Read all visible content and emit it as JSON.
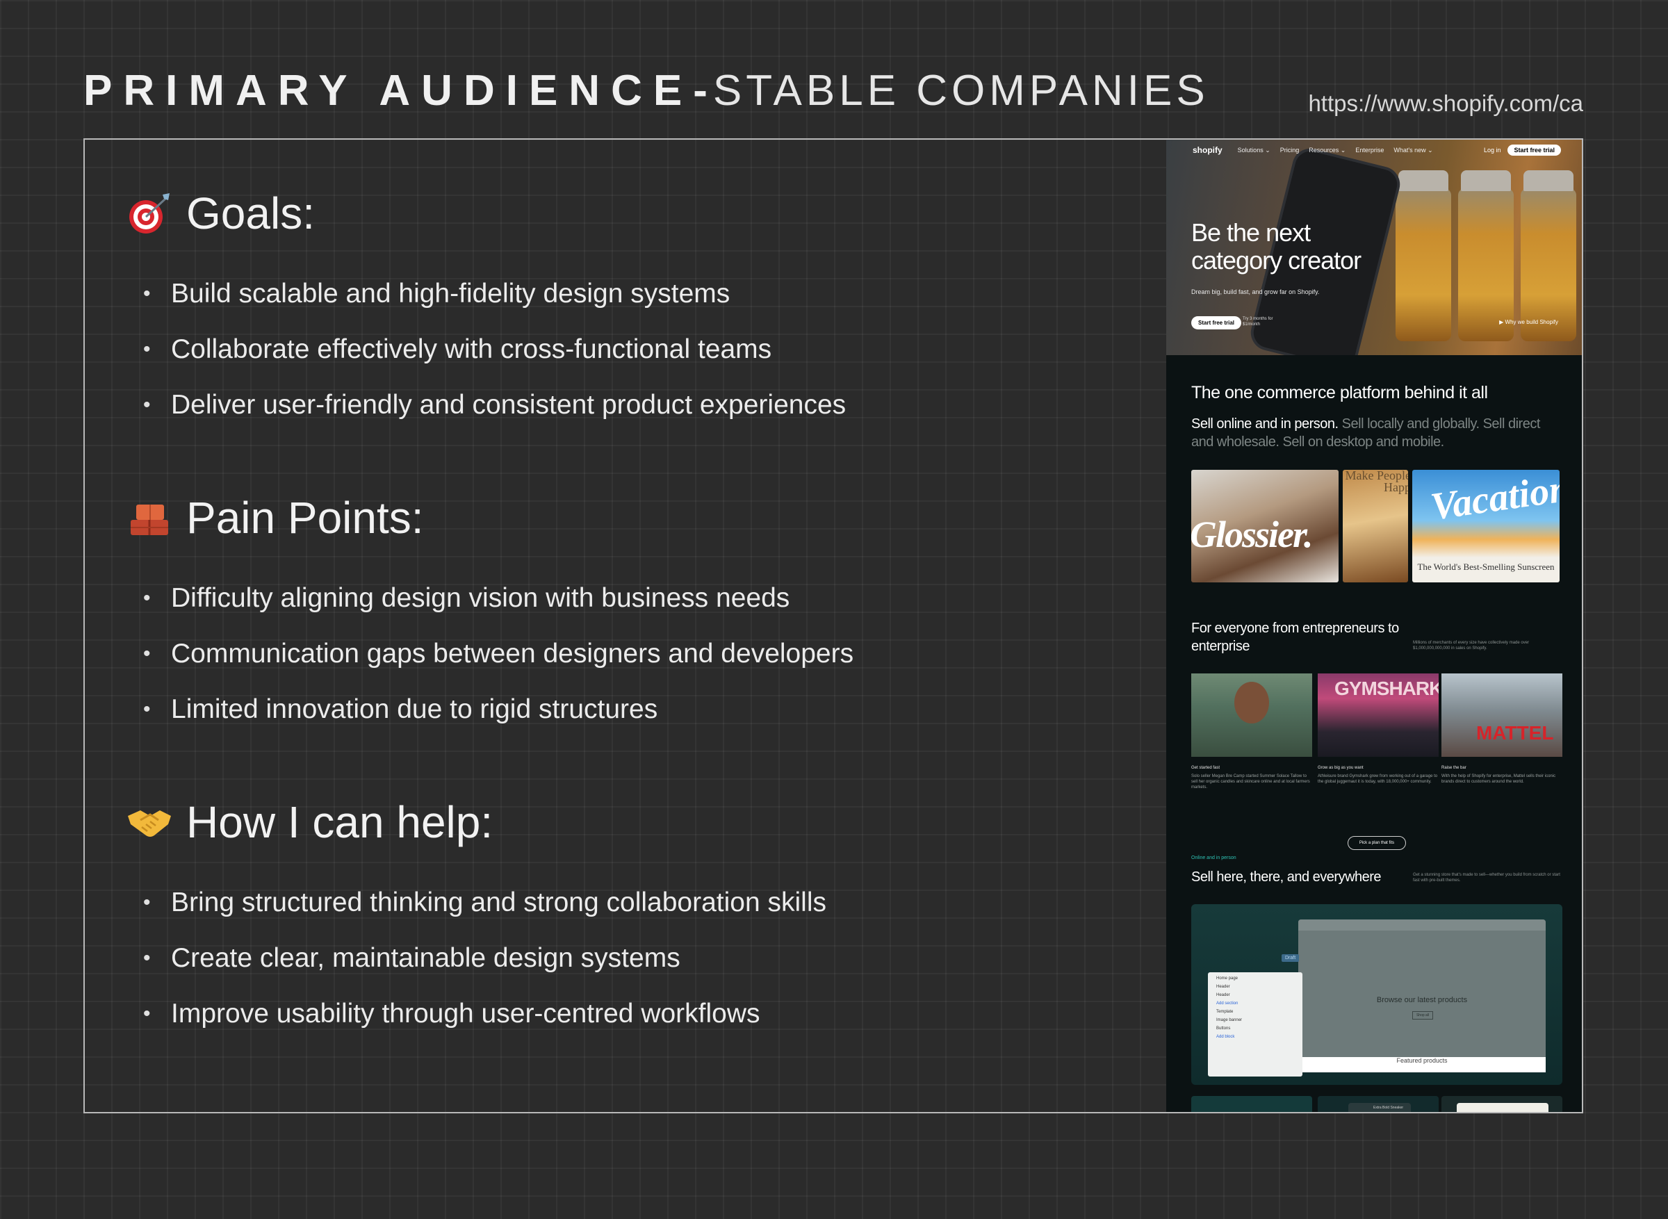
{
  "header": {
    "title_bold": "PRIMARY AUDIENCE",
    "title_sep": "-",
    "title_light": "STABLE COMPANIES",
    "source_url": "https://www.shopify.com/ca"
  },
  "sections": [
    {
      "icon": "dart-target-icon",
      "title": "Goals:",
      "bullets": [
        "Build scalable and high-fidelity design systems",
        "Collaborate effectively with cross-functional teams",
        "Deliver user-friendly and consistent product experiences"
      ]
    },
    {
      "icon": "bricks-icon",
      "title": "Pain Points:",
      "bullets": [
        "Difficulty aligning design vision with business needs",
        "Communication gaps between designers and developers",
        "Limited innovation due to rigid structures"
      ]
    },
    {
      "icon": "handshake-icon",
      "title": "How I can help:",
      "bullets": [
        "Bring structured thinking and strong collaboration skills",
        "Create clear, maintainable design systems",
        "Improve usability through user-centred workflows"
      ]
    }
  ],
  "shopify": {
    "nav": {
      "logo": "shopify",
      "items": [
        "Solutions ⌄",
        "Pricing",
        "Resources ⌄",
        "Enterprise",
        "What's new ⌄"
      ],
      "login": "Log in",
      "cta": "Start free trial"
    },
    "hero": {
      "title": "Be the next category creator",
      "subtitle": "Dream big, build fast, and grow far on Shopify.",
      "cta": "Start free trial",
      "note": "Try 3 months for $1/month",
      "link": "▶ Why we build Shopify"
    },
    "platform": {
      "heading": "The one commerce platform behind it all",
      "sub_strong": "Sell online and in person.",
      "sub_muted": " Sell locally and globally. Sell direct and wholesale. Sell on desktop and mobile.",
      "brand_glossier": "Glossier.",
      "brand_middle": "Make People Happ",
      "brand_vacation": "Vacation",
      "brand_vacation_sub": "The World's Best-Smelling Sunscreen"
    },
    "everyone": {
      "heading": "For everyone from entrepreneurs to enterprise",
      "note": "Millions of merchants of every size have collectively made over $1,000,000,000,000 in sales on Shopify.",
      "cards": [
        {
          "title": "Get started fast",
          "text": "Solo seller Megan Bre Camp started Summer Solace Tallow to sell her organic candles and skincare online and at local farmers markets."
        },
        {
          "title": "Grow as big as you want",
          "text": "Athleisure brand Gymshark grew from working out of a garage to the global juggernaut it is today, with 18,000,000+ community."
        },
        {
          "title": "Raise the bar",
          "text": "With the help of Shopify for enterprise, Mattel sells their iconic brands direct to customers around the world."
        }
      ],
      "gymshark": "GYMSHARK",
      "mattel": "MATTEL",
      "pick_button": "Pick a plan that fits"
    },
    "sell": {
      "tag": "Online and in person",
      "heading": "Sell here, there, and everywhere",
      "note": "Get a stunning store that's made to sell—whether you build from scratch or start fast with pre-built themes.",
      "editor_draft": "Draft",
      "editor_browse": "Browse our latest products",
      "editor_btn": "Shop all",
      "editor_items": [
        "Home page",
        "Header",
        "Header",
        "Add section",
        "Template",
        "Image banner",
        "Buttons",
        "Add block"
      ],
      "editor_featured": "Featured products",
      "strip_label": "Extra Bold Sneaker"
    }
  },
  "colors": {
    "background": "#2b2b2b",
    "frame_border": "#b9b9b9",
    "text": "#ececec",
    "shopify_panel": "#0b1213",
    "accent_teal": "#2fc3b5"
  }
}
